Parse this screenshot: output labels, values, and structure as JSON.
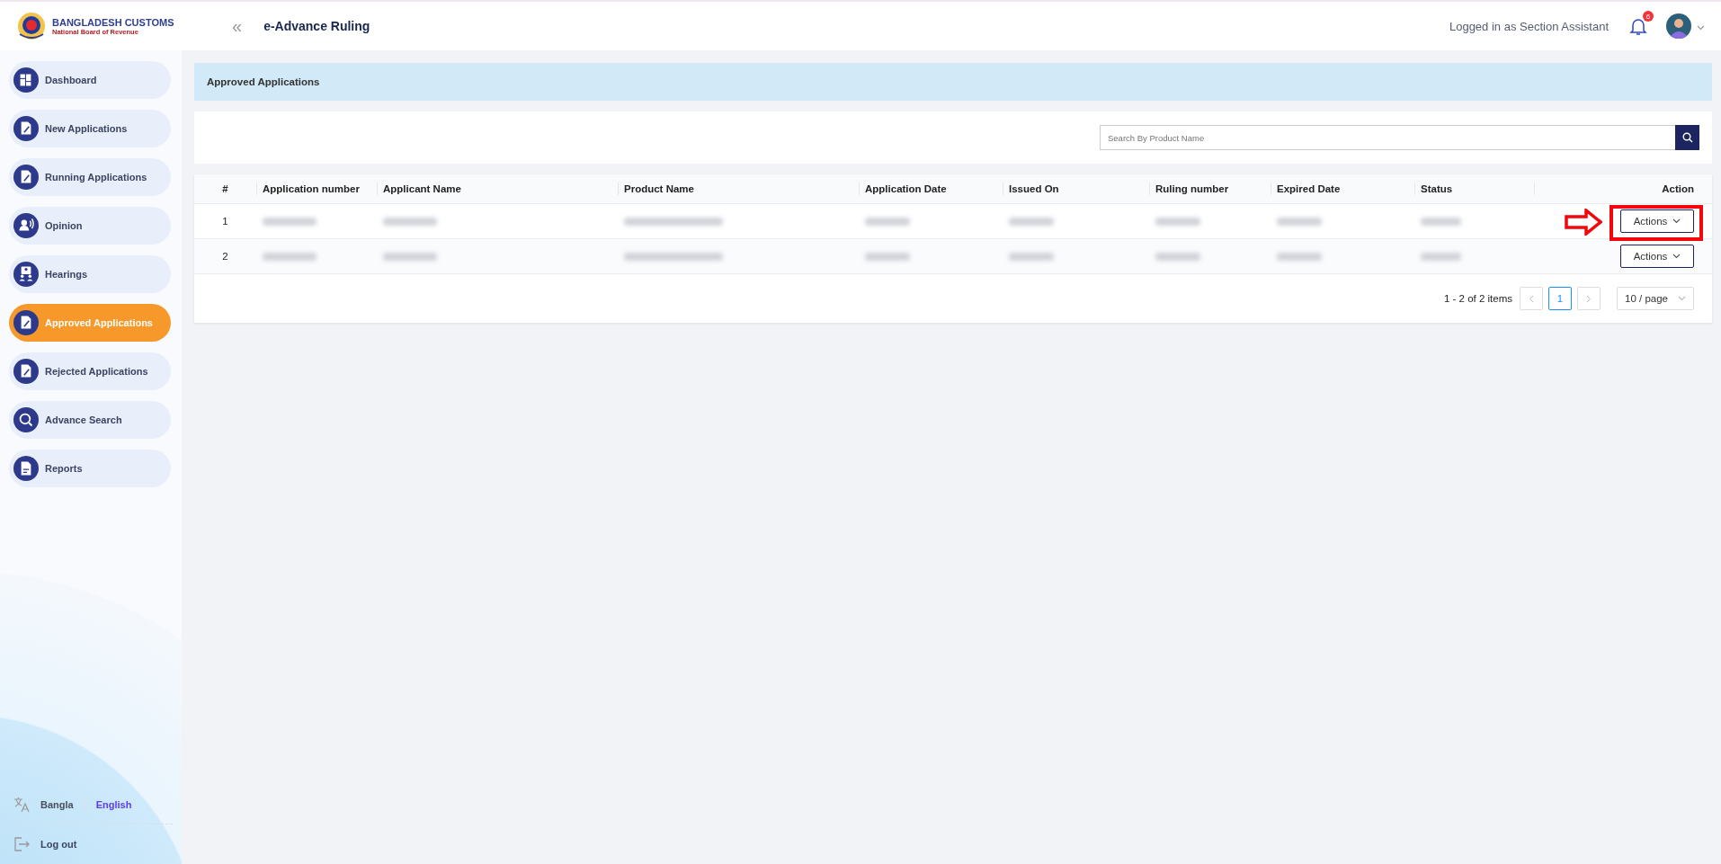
{
  "header": {
    "logo_title": "BANGLADESH CUSTOMS",
    "logo_subtitle": "National Board of Revenue",
    "collapse_glyph": "«",
    "app_title": "e-Advance Ruling",
    "user_label": "Logged in as Section Assistant",
    "notification_count": "6"
  },
  "sidebar": {
    "items": [
      {
        "label": "Dashboard",
        "kind": "grid",
        "selected": false
      },
      {
        "label": "New Applications",
        "kind": "doc",
        "selected": false
      },
      {
        "label": "Running Applications",
        "kind": "doc",
        "selected": false
      },
      {
        "label": "Opinion",
        "kind": "speaker",
        "selected": false
      },
      {
        "label": "Hearings",
        "kind": "meeting",
        "selected": false
      },
      {
        "label": "Approved Applications",
        "kind": "doc",
        "selected": true
      },
      {
        "label": "Rejected Applications",
        "kind": "doc",
        "selected": false
      },
      {
        "label": "Advance Search",
        "kind": "search",
        "selected": false
      },
      {
        "label": "Reports",
        "kind": "report",
        "selected": false
      }
    ],
    "languages": [
      {
        "label": "Bangla",
        "selected": false
      },
      {
        "label": "English",
        "selected": true
      }
    ],
    "logout": "Log out"
  },
  "page_title": "Approved Applications",
  "search": {
    "placeholder": "Search By Product Name"
  },
  "table": {
    "columns": [
      "#",
      "Application number",
      "Applicant Name",
      "Product Name",
      "Application Date",
      "Issued On",
      "Ruling number",
      "Expired Date",
      "Status",
      "Action"
    ],
    "rows": [
      {
        "index": "1",
        "action": "Actions",
        "highlighted": true
      },
      {
        "index": "2",
        "action": "Actions",
        "highlighted": false
      }
    ]
  },
  "pagination": {
    "summary": "1 - 2 of 2 items",
    "pages": [
      {
        "label": "1",
        "selected": true
      }
    ],
    "page_size": "10 / page"
  }
}
